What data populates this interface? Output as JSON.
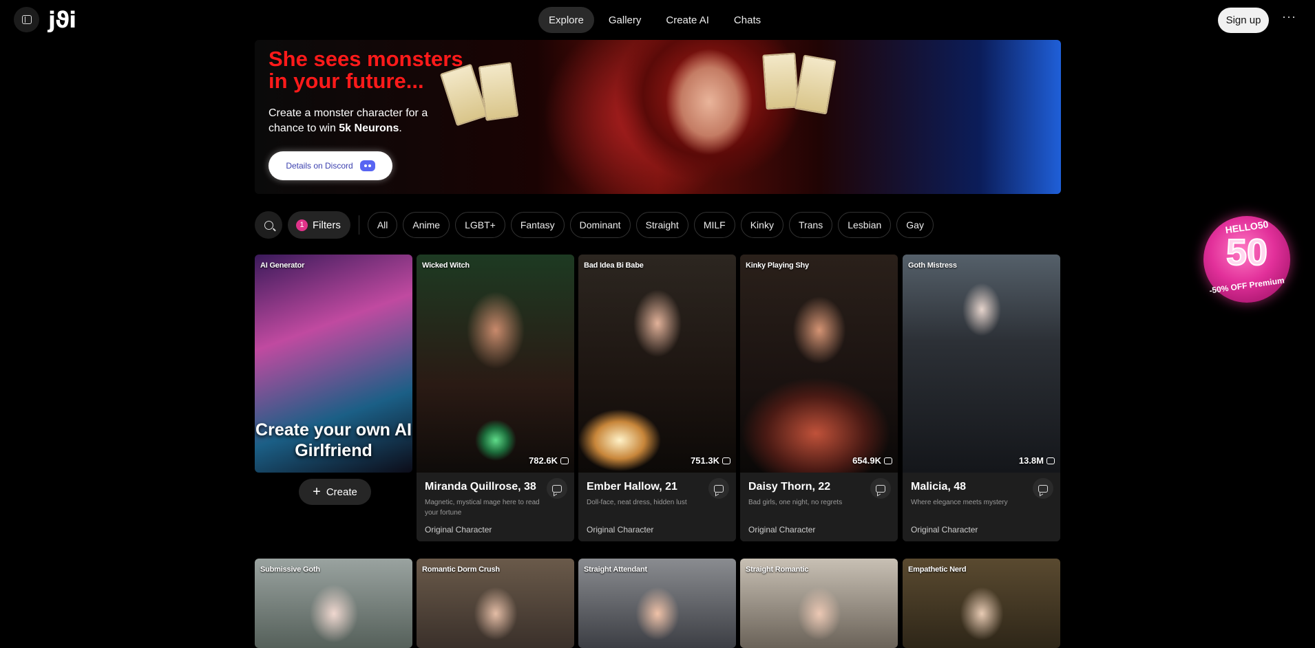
{
  "header": {
    "logo": "jϑi",
    "nav": [
      "Explore",
      "Gallery",
      "Create AI",
      "Chats"
    ],
    "signup": "Sign up",
    "more": "···"
  },
  "banner": {
    "title_line1": "She sees monsters",
    "title_line2": "in your future...",
    "subtitle_prefix": "Create a monster character for a chance to win ",
    "subtitle_bold": "5k Neurons",
    "subtitle_suffix": ".",
    "button": "Details on Discord"
  },
  "filters": {
    "label": "Filters",
    "badge": "1",
    "tags": [
      "All",
      "Anime",
      "LGBT+",
      "Fantasy",
      "Dominant",
      "Straight",
      "MILF",
      "Kinky",
      "Trans",
      "Lesbian",
      "Gay"
    ]
  },
  "generator": {
    "tag": "AI Generator",
    "title": "Create your own AI Girlfriend",
    "button": "Create"
  },
  "cards": [
    {
      "tag": "Wicked Witch",
      "stat": "782.6K",
      "name": "Miranda Quillrose, 38",
      "desc": "Magnetic, mystical mage here to read your fortune",
      "origin": "Original Character"
    },
    {
      "tag": "Bad Idea Bi Babe",
      "stat": "751.3K",
      "name": "Ember Hallow, 21",
      "desc": "Doll-face, neat dress, hidden lust",
      "origin": "Original Character"
    },
    {
      "tag": "Kinky Playing Shy",
      "stat": "654.9K",
      "name": "Daisy Thorn, 22",
      "desc": "Bad girls, one night, no regrets",
      "origin": "Original Character"
    },
    {
      "tag": "Goth Mistress",
      "stat": "13.8M",
      "name": "Malicia, 48",
      "desc": "Where elegance meets mystery",
      "origin": "Original Character"
    }
  ],
  "row2": [
    "Submissive Goth",
    "Romantic Dorm Crush",
    "Straight Attendant",
    "Straight Romantic",
    "Empathetic Nerd"
  ],
  "promo": {
    "top": "HELLO50",
    "num": "50",
    "bottom": "-50% OFF Premium"
  },
  "colors": {
    "accent": "#e0338a",
    "banner_title": "#ff1a1a"
  }
}
